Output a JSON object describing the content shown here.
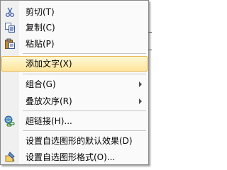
{
  "menu": {
    "items": [
      {
        "label": "剪切(T)",
        "icon": "scissors-icon"
      },
      {
        "label": "复制(C)",
        "icon": "copy-icon"
      },
      {
        "label": "粘贴(P)",
        "icon": "paste-icon"
      },
      {
        "label": "添加文字(X)",
        "icon": ""
      },
      {
        "label": "组合(G)",
        "icon": ""
      },
      {
        "label": "叠放次序(R)",
        "icon": ""
      },
      {
        "label": "超链接(H)...",
        "icon": "hyperlink-icon"
      },
      {
        "label": "设置自选图形的默认效果(D)",
        "icon": ""
      },
      {
        "label": "设置自选图形格式(O)...",
        "icon": "format-shape-icon"
      }
    ],
    "highlight_color": "#ffe59a"
  }
}
